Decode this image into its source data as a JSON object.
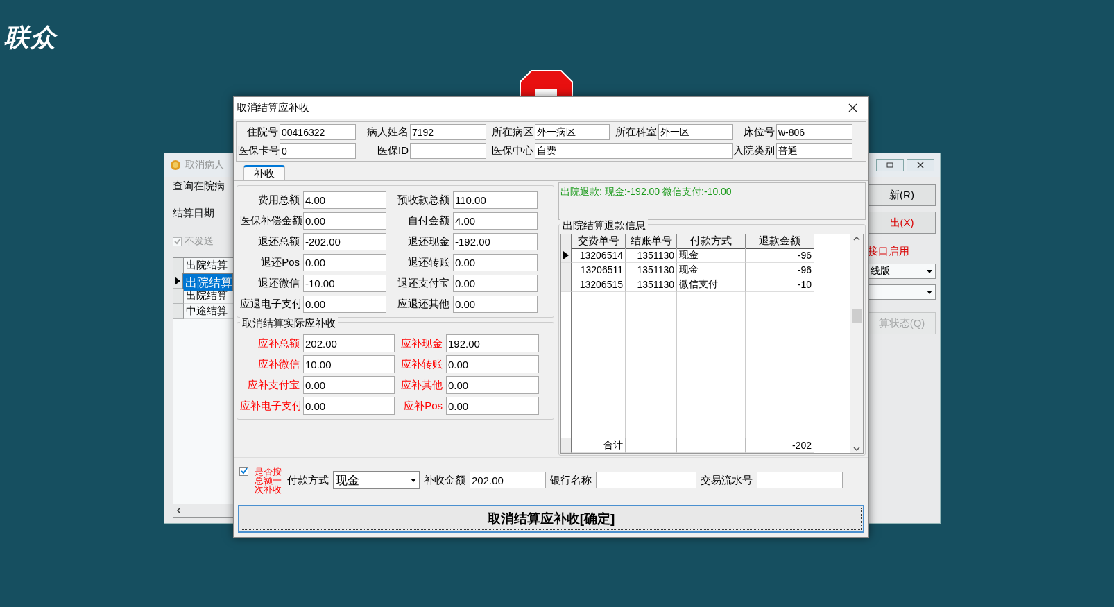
{
  "desktop": {
    "logo": "联众"
  },
  "back_window": {
    "title": "取消病人",
    "group_title": "查询在院病",
    "date_label": "结算日期",
    "checkbox": {
      "label": "不发送",
      "checked": true
    },
    "list": [
      {
        "label": "出院结算",
        "selected": false
      },
      {
        "label": "出院结算",
        "selected": true
      },
      {
        "label": "出院结算",
        "selected": false
      },
      {
        "label": "中途结算",
        "selected": false
      }
    ],
    "buttons": [
      {
        "label": "新(R)",
        "kind": "normal"
      },
      {
        "label": "出(X)",
        "kind": "danger"
      }
    ],
    "interface_label": "接口启用",
    "combo": {
      "value": "线版"
    },
    "status_button": {
      "label": "算状态(Q)",
      "disabled": true
    }
  },
  "dialog": {
    "title": "取消结算应补收",
    "info_rows": [
      [
        {
          "label": "住院号",
          "value": "00416322",
          "wide": false
        },
        {
          "label": "病人姓名",
          "value": "7192",
          "wide": false
        },
        {
          "label": "所在病区",
          "value": "外一病区",
          "wide": false
        },
        {
          "label": "所在科室",
          "value": "外一区",
          "wide": false
        },
        {
          "label": "床位号",
          "value": "w-806",
          "wide": false
        }
      ],
      [
        {
          "label": "医保卡号",
          "value": "0",
          "wide": false
        },
        {
          "label": "医保ID",
          "wide": false
        },
        {
          "label": "医保中心",
          "value": "自费",
          "wide": true
        },
        {
          "label": "入院类别",
          "value": "普通",
          "wide": false
        }
      ]
    ],
    "tabs": [
      {
        "label": "补收",
        "selected": true
      }
    ],
    "refund_fields": [
      {
        "label": "费用总额",
        "value": "4.00"
      },
      {
        "label": "预收款总额",
        "value": "110.00"
      },
      {
        "label": "医保补偿金额",
        "value": "0.00"
      },
      {
        "label": "自付金额",
        "value": "4.00"
      },
      {
        "label": "退还总额",
        "value": "-202.00"
      },
      {
        "label": "退还现金",
        "value": "-192.00"
      },
      {
        "label": "退还Pos",
        "value": "0.00"
      },
      {
        "label": "退还转账",
        "value": "0.00"
      },
      {
        "label": "退还微信",
        "value": "-10.00"
      },
      {
        "label": "退还支付宝",
        "value": "0.00"
      },
      {
        "label": "应退电子支付",
        "value": "0.00"
      },
      {
        "label": "应退还其他",
        "value": "0.00"
      }
    ],
    "due_group_title": "取消结算实际应补收",
    "due_fields": [
      {
        "label": "应补总额",
        "value": "202.00"
      },
      {
        "label": "应补现金",
        "value": "192.00"
      },
      {
        "label": "应补微信",
        "value": "10.00"
      },
      {
        "label": "应补转账",
        "value": "0.00"
      },
      {
        "label": "应补支付宝",
        "value": "0.00"
      },
      {
        "label": "应补其他",
        "value": "0.00"
      },
      {
        "label": "应补电子支付",
        "value": "0.00"
      },
      {
        "label": "应补Pos",
        "value": "0.00"
      }
    ],
    "refund_summary": "出院退款: 现金:-192.00 微信支付:-10.00",
    "grid": {
      "title": "出院结算退款信息",
      "columns": [
        "交费单号",
        "结账单号",
        "付款方式",
        "退款金额"
      ],
      "rows": [
        {
          "cells": [
            "13206514",
            "1351130",
            "现金",
            "-96"
          ],
          "selected": true
        },
        {
          "cells": [
            "13206511",
            "1351130",
            "现金",
            "-96"
          ],
          "selected": false
        },
        {
          "cells": [
            "13206515",
            "1351130",
            "微信支付",
            "-10"
          ],
          "selected": false
        }
      ],
      "total": {
        "label": "合计",
        "amount": "-202"
      }
    },
    "one_time": {
      "label": "是否按总额一次补收",
      "checked": true
    },
    "pay_method": {
      "label": "付款方式",
      "value": "现金"
    },
    "amount": {
      "label": "补收金额",
      "value": "202.00"
    },
    "bank": {
      "label": "银行名称"
    },
    "serial": {
      "label": "交易流水号"
    },
    "confirm_button": "取消结算应补收[确定]"
  }
}
